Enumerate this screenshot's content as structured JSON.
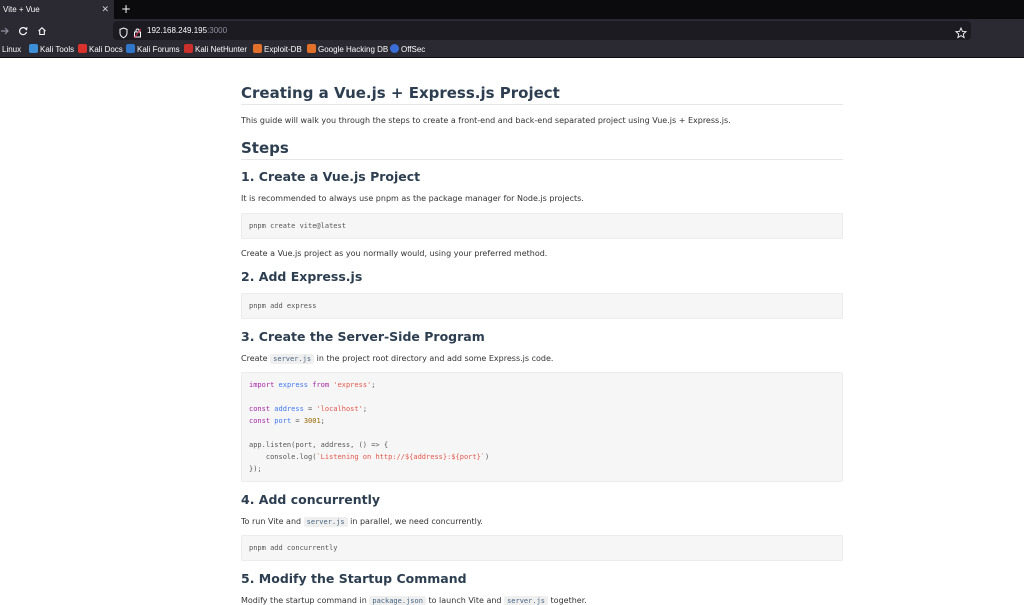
{
  "browser": {
    "tab_title": "Vite + Vue",
    "tab_close": "✕",
    "new_tab": "+",
    "url_host": "192.168.249.195",
    "url_port": ":3000",
    "bookmarks": [
      {
        "label": "i Linux",
        "color": ""
      },
      {
        "label": "Kali Tools",
        "color": "#3c8fd6"
      },
      {
        "label": "Kali Docs",
        "color": "#d9322c"
      },
      {
        "label": "Kali Forums",
        "color": "#2f76c8"
      },
      {
        "label": "Kali NetHunter",
        "color": "#c9302c"
      },
      {
        "label": "Exploit-DB",
        "color": "#e0702a"
      },
      {
        "label": "Google Hacking DB",
        "color": "#e0702a"
      },
      {
        "label": "OffSec",
        "color": "#3a6fd8"
      }
    ]
  },
  "page": {
    "title": "Creating a Vue.js + Express.js Project",
    "intro": "This guide will walk you through the steps to create a front-end and back-end separated project using Vue.js + Express.js.",
    "steps_heading": "Steps",
    "step1": {
      "heading": "1. Create a Vue.js Project",
      "text": "It is recommended to always use pnpm as the package manager for Node.js projects.",
      "code": "pnpm create vite@latest",
      "after": "Create a Vue.js project as you normally would, using your preferred method."
    },
    "step2": {
      "heading": "2. Add Express.js",
      "code": "pnpm add express"
    },
    "step3": {
      "heading": "3. Create the Server-Side Program",
      "text_before": "Create",
      "inline": "server.js",
      "text_after": "in the project root directory and add some Express.js code.",
      "code": {
        "l1_kw1": "import",
        "l1_id": "express",
        "l1_kw2": "from",
        "l1_str": "'express'",
        "l1_end": ";",
        "l3_kw": "const",
        "l3_id": "address",
        "l3_eq": " = ",
        "l3_str": "'localhost'",
        "l3_end": ";",
        "l4_kw": "const",
        "l4_id": "port",
        "l4_eq": " = ",
        "l4_num": "3001",
        "l4_end": ";",
        "l6": "app.listen(port, address, () => {",
        "l7_pre": "    console.log(",
        "l7_str": "`Listening on http://${address}:${port}`",
        "l7_end": ")",
        "l8": "});"
      }
    },
    "step4": {
      "heading": "4. Add concurrently",
      "text_before": "To run Vite and",
      "inline": "server.js",
      "text_after": "in parallel, we need concurrently.",
      "code": "pnpm add concurrently"
    },
    "step5": {
      "heading": "5. Modify the Startup Command",
      "text_before": "Modify the startup command in",
      "inline1": "package.json",
      "text_mid": "to launch Vite and",
      "inline2": "server.js",
      "text_after": "together."
    }
  }
}
